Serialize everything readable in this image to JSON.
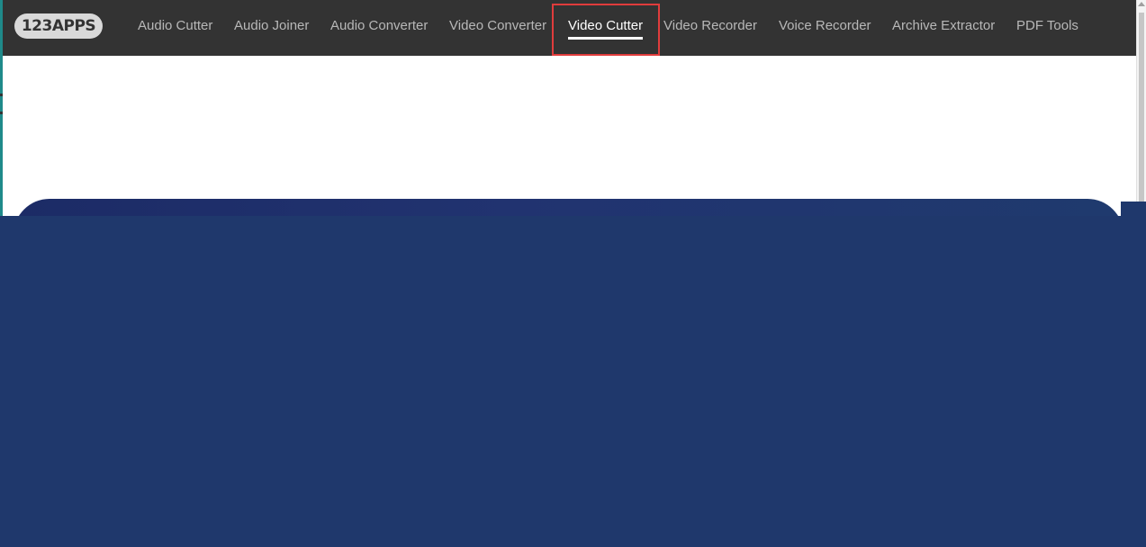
{
  "brand": {
    "logo_text": "123APPS"
  },
  "nav": {
    "items": [
      {
        "label": "Audio Cutter",
        "active": false
      },
      {
        "label": "Audio Joiner",
        "active": false
      },
      {
        "label": "Audio Converter",
        "active": false
      },
      {
        "label": "Video Converter",
        "active": false
      },
      {
        "label": "Video Cutter",
        "active": true
      },
      {
        "label": "Video Recorder",
        "active": false
      },
      {
        "label": "Voice Recorder",
        "active": false
      },
      {
        "label": "Archive Extractor",
        "active": false
      },
      {
        "label": "PDF Tools",
        "active": false
      }
    ]
  },
  "colors": {
    "navbar_bg": "#333333",
    "nav_text": "#b8b8b8",
    "nav_active_text": "#ffffff",
    "highlight_border": "#e03c3c",
    "overlay_bg": "#1f386c",
    "hero_gradient_start": "#1c2b66"
  }
}
